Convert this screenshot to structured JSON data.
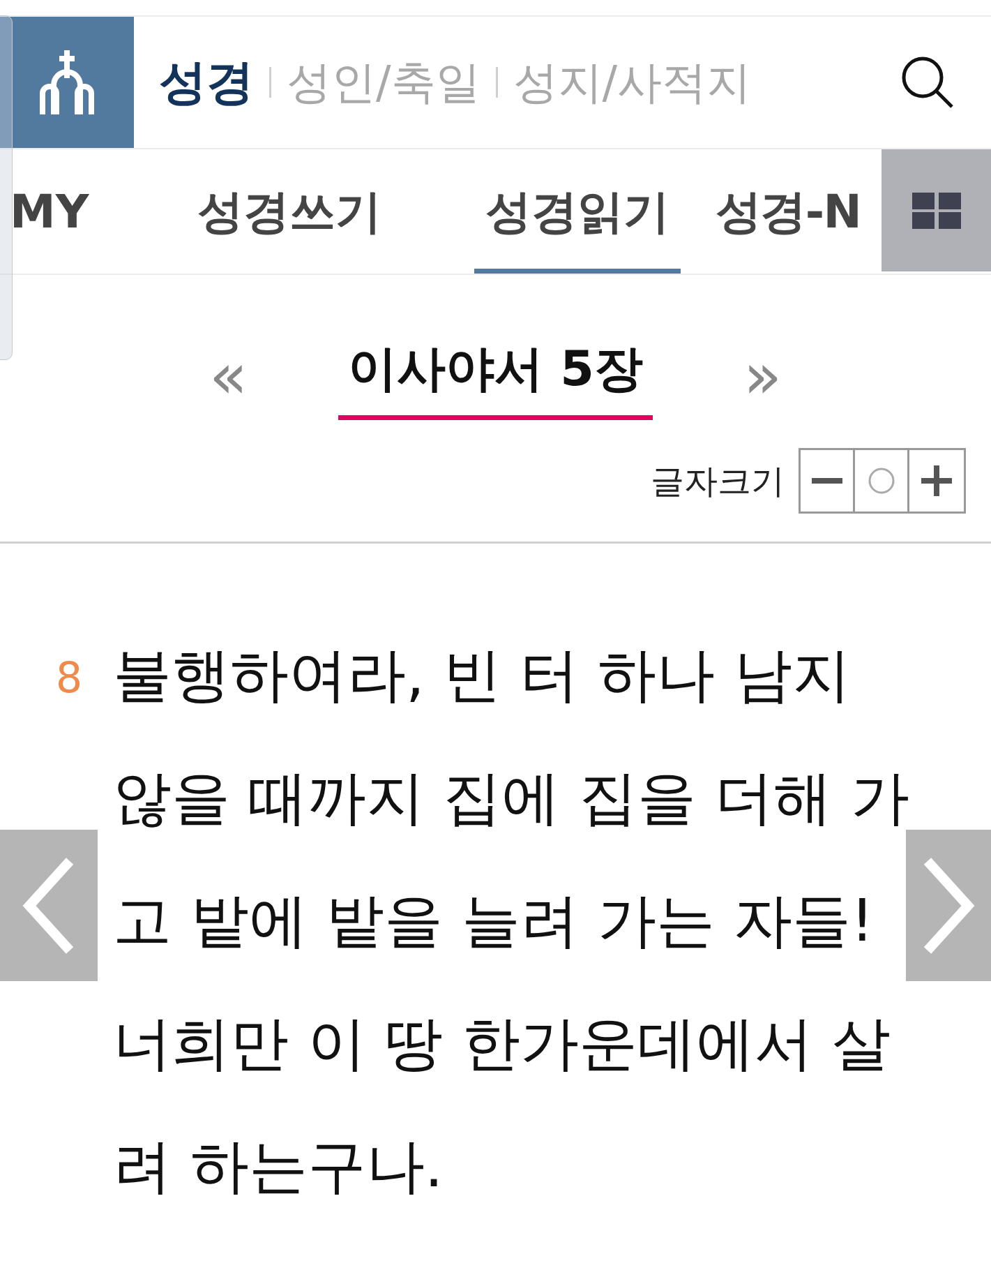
{
  "header": {
    "sections": [
      {
        "label": "성경",
        "selected": true
      },
      {
        "label": "성인/축일",
        "selected": false
      },
      {
        "label": "성지/사적지",
        "selected": false
      }
    ]
  },
  "tabs": [
    {
      "label": "MY",
      "selected": false
    },
    {
      "label": "성경쓰기",
      "selected": false
    },
    {
      "label": "성경읽기",
      "selected": true
    },
    {
      "label": "성경-N",
      "selected": false
    }
  ],
  "chapter": {
    "title": "이사야서 5장",
    "prev": "«",
    "next": "»"
  },
  "font_size": {
    "label": "글자크기"
  },
  "verses": [
    {
      "number": "8",
      "text": "불행하여라, 빈 터 하나 남지 않을 때까지 집에 집을 더해 가고 밭에 밭을 늘려 가는 자들! 너희만 이 땅 한가운데에서 살려 하는구나."
    }
  ]
}
